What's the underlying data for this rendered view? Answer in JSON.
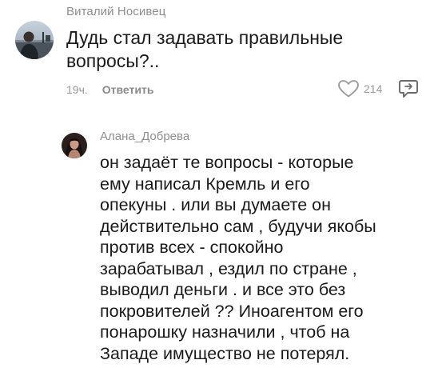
{
  "comment": {
    "author": "Виталий Носивец",
    "text_lines": [
      "Дудь стал задавать правильные",
      "вопросы?.."
    ],
    "time": "19ч.",
    "reply_label": "Ответить",
    "likes": "214"
  },
  "reply": {
    "author": "Алана_Добрева",
    "text_lines": [
      "он задаёт те вопросы - которые",
      "ему написал Кремль и его",
      "опекуны . или вы думаете он",
      "действительно сам , будучи якобы",
      "против всех - спокойно",
      "зарабатывал , ездил по стране ,",
      "выводил деньги . и все это без",
      "покровителей ?? Иноагентом его",
      "понарошку назначили , чтоб на",
      "Западе имущество не потерял."
    ]
  },
  "icons": {
    "like": "heart-outline-icon",
    "share": "speech-bubble-share-icon"
  }
}
